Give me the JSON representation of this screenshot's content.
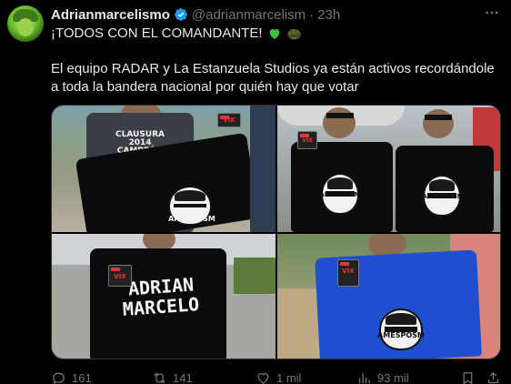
{
  "author": {
    "display_name": "Adrianmarcelismo",
    "handle": "@adrianmarcelism",
    "separator": "·",
    "time": "23h",
    "verified": true,
    "more_icon": "more-horizontal-icon"
  },
  "tweet": {
    "headline": "¡TODOS CON EL COMANDANTE!",
    "headline_emojis": [
      "green-heart-emoji",
      "military-helmet-emoji"
    ],
    "body": "El equipo RADAR y La Estanzuela Studios ya están activos recordándole a toda la bandera nacional por quién hay que votar"
  },
  "media": {
    "photos": [
      {
        "alt": "photo-1",
        "shirt_print": "AMESPOSM",
        "tag": "VIX",
        "other_shirt_text": "CLAUSURA 2014 CAMPEÓN"
      },
      {
        "alt": "photo-2",
        "shirt_print": "AMESPOSM",
        "tag": "VIX"
      },
      {
        "alt": "photo-3",
        "shirt_print_line1": "ADRIAN",
        "shirt_print_line2": "MARCELO",
        "tag": "VIX"
      },
      {
        "alt": "photo-4",
        "shirt_print": "AMESPOSM",
        "tag": "VIX"
      }
    ]
  },
  "actions": {
    "replies": "161",
    "reposts": "141",
    "likes": "1 mil",
    "views": "93 mil"
  },
  "colors": {
    "background": "#000000",
    "text": "#e7e9ea",
    "muted": "#71767b",
    "verified": "#1d9bf0",
    "heart": "#3ec43e"
  }
}
